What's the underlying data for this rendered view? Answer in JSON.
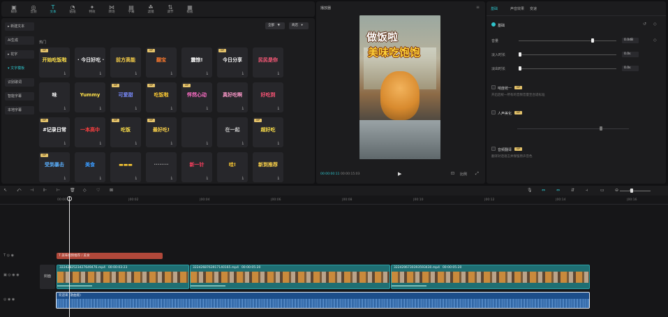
{
  "toolbar": {
    "items": [
      {
        "icon": "▣",
        "label": "媒体"
      },
      {
        "icon": "◎",
        "label": "音频"
      },
      {
        "icon": "T",
        "label": "文本"
      },
      {
        "icon": "◔",
        "label": "贴纸"
      },
      {
        "icon": "✦",
        "label": "特效"
      },
      {
        "icon": "⋈",
        "label": "转场"
      },
      {
        "icon": "▤",
        "label": "字幕"
      },
      {
        "icon": "☘",
        "label": "滤镜"
      },
      {
        "icon": "⇅",
        "label": "调节"
      },
      {
        "icon": "▦",
        "label": "模板"
      }
    ],
    "active_index": 2
  },
  "nav": {
    "items": [
      "▸ 新建文本",
      "AI生成",
      "▸ 花字",
      "▾ 文字模板",
      "识别歌词",
      "智能字幕",
      "本地字幕"
    ],
    "active_index": 3
  },
  "filters": {
    "all": "全部",
    "all_icon": "⧨",
    "source": "商店",
    "source_icon": "▾"
  },
  "section": "热门",
  "tiles": [
    {
      "text": "开始吃饭啦",
      "color": "#ffe14a",
      "vip": true
    },
    {
      "text": "· 今日好吃 ·",
      "color": "#f0f0f0",
      "vip": false
    },
    {
      "text": "前方高能",
      "color": "#ffd54a",
      "vip": false
    },
    {
      "text": "翻宝",
      "color": "#ff7a2e",
      "vip": true
    },
    {
      "text": "震惊!",
      "color": "#ffffff",
      "vip": false
    },
    {
      "text": "今日分享",
      "color": "#f2f2f2",
      "vip": true
    },
    {
      "text": "民民是你",
      "color": "#ff5a7a",
      "vip": false
    },
    {
      "text": "味",
      "color": "#ffffff",
      "vip": false
    },
    {
      "text": "Yummy",
      "color": "#ffe14a",
      "vip": false
    },
    {
      "text": "可爱甜",
      "color": "#7a8cff",
      "vip": true
    },
    {
      "text": "吃饭啦",
      "color": "#ffcc33",
      "vip": true
    },
    {
      "text": "怦然心动",
      "color": "#ff6ec7",
      "vip": true
    },
    {
      "text": "真好吃啊",
      "color": "#ff9acb",
      "vip": false
    },
    {
      "text": "好吃到",
      "color": "#ff5577",
      "vip": false
    },
    {
      "text": "#记录日常",
      "color": "#ffffff",
      "vip": true
    },
    {
      "text": "一本高中",
      "color": "#ff4040",
      "vip": false
    },
    {
      "text": "吃饭",
      "color": "#ffe14a",
      "vip": true
    },
    {
      "text": "最好吃!",
      "color": "#ffd54a",
      "vip": true
    },
    {
      "text": "",
      "color": "#aaaaaa",
      "vip": false
    },
    {
      "text": "在一起",
      "color": "#cccccc",
      "vip": false
    },
    {
      "text": "超好吃",
      "color": "#ffe14a",
      "vip": true
    },
    {
      "text": "受到暴击",
      "color": "#5ab0ff",
      "vip": true
    },
    {
      "text": "美食",
      "color": "#3a9bff",
      "vip": false
    },
    {
      "text": "▬▬▬",
      "color": "#ffcc33",
      "vip": false
    },
    {
      "text": "········",
      "color": "#999999",
      "vip": false
    },
    {
      "text": "新一针",
      "color": "#ff4060",
      "vip": false
    },
    {
      "text": "哇!",
      "color": "#ffcc33",
      "vip": false
    },
    {
      "text": "新到推荐",
      "color": "#ffd54a",
      "vip": false
    }
  ],
  "vip_label": "VIP",
  "download_icon": "⤓",
  "player": {
    "title": "播放器",
    "menu_icon": "≡",
    "overlay_line1": "做饭啦",
    "overlay_line2": "美味吃饱饱",
    "time_current": "00:00:00:11",
    "time_total": "00:00:15:03",
    "play_icon": "▶",
    "ratio": "比例",
    "scan_icon": "⊡",
    "full_icon": "⤢",
    "extra_icon": "◫"
  },
  "props": {
    "tabs": [
      "基础",
      "声音效果",
      "变速"
    ],
    "active_tab": 0,
    "basic": {
      "title": "基础",
      "volume_label": "音量",
      "volume_value": "0.0dB",
      "fadein_label": "淡入时长",
      "fadein_value": "0.0s",
      "fadeout_label": "淡出时长",
      "fadeout_value": "0.0s"
    },
    "sections": [
      {
        "label": "响度统一",
        "vip": true,
        "desc": "开启后统一所有的音频音量至合适标准"
      },
      {
        "label": "人声美化",
        "vip": true,
        "desc": ""
      },
      {
        "label": "音频翻译",
        "vip": true,
        "desc": "翻译对话语言并保留原声音色"
      }
    ],
    "icons": {
      "reset": "↺",
      "keyframe": "◇"
    }
  },
  "timeline": {
    "tools_left": [
      "↖",
      "⤺",
      "⊣",
      "⊩",
      "⊢",
      "🗑",
      "◇",
      "♡",
      "⊠"
    ],
    "tools_right": [
      "🎙",
      "⇔",
      "⇔",
      "⇵",
      "⫞",
      "▭",
      "⊖",
      "⊕"
    ],
    "ruler": [
      "00:00",
      "|00:02",
      "|00:04",
      "|00:06",
      "|00:08",
      "|00:10",
      "|00:12",
      "|00:14",
      "|00:16"
    ],
    "text_clip": "T 美味视频推荐 / 美食",
    "cover_label": "封面",
    "video_clips": [
      {
        "name": "3224282523427649476.mp4",
        "duration": "00:00:03:23"
      },
      {
        "name": "3224268763917140165.mp4",
        "duration": "00:00:05:20"
      },
      {
        "name": "3224206730393593430.mp4",
        "duration": "00:00:05:20"
      }
    ],
    "audio_clip": "欢迎来 (歌曲版)"
  },
  "colors": {
    "accent": "#2ec4cc",
    "text_clip": "#b0483a",
    "video_clip": "#1f6f73",
    "audio_clip": "#1c4e8a"
  }
}
